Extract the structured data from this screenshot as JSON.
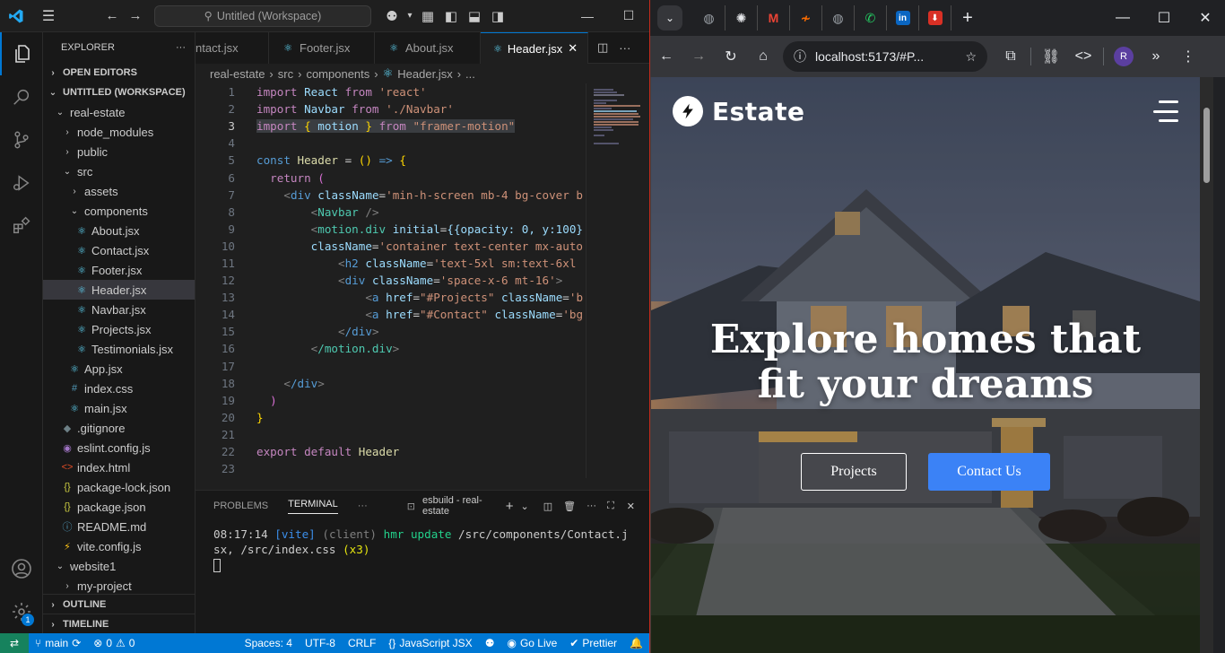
{
  "vscode": {
    "command_center": "Untitled (Workspace)",
    "sidebar": {
      "title": "EXPLORER",
      "open_editors": "OPEN EDITORS",
      "workspace": "UNTITLED (WORKSPACE)",
      "tree": [
        {
          "label": "real-estate",
          "kind": "folder-open"
        },
        {
          "label": "node_modules",
          "kind": "folder"
        },
        {
          "label": "public",
          "kind": "folder"
        },
        {
          "label": "src",
          "kind": "folder-open"
        },
        {
          "label": "assets",
          "kind": "folder"
        },
        {
          "label": "components",
          "kind": "folder-open"
        },
        {
          "label": "About.jsx",
          "kind": "jsx"
        },
        {
          "label": "Contact.jsx",
          "kind": "jsx"
        },
        {
          "label": "Footer.jsx",
          "kind": "jsx"
        },
        {
          "label": "Header.jsx",
          "kind": "jsx"
        },
        {
          "label": "Navbar.jsx",
          "kind": "jsx"
        },
        {
          "label": "Projects.jsx",
          "kind": "jsx"
        },
        {
          "label": "Testimonials.jsx",
          "kind": "jsx"
        },
        {
          "label": "App.jsx",
          "kind": "jsx"
        },
        {
          "label": "index.css",
          "kind": "css"
        },
        {
          "label": "main.jsx",
          "kind": "jsx"
        },
        {
          "label": ".gitignore",
          "kind": "git"
        },
        {
          "label": "eslint.config.js",
          "kind": "eslint"
        },
        {
          "label": "index.html",
          "kind": "html"
        },
        {
          "label": "package-lock.json",
          "kind": "json"
        },
        {
          "label": "package.json",
          "kind": "json"
        },
        {
          "label": "README.md",
          "kind": "info"
        },
        {
          "label": "vite.config.js",
          "kind": "vite"
        },
        {
          "label": "website1",
          "kind": "folder-open"
        },
        {
          "label": "my-project",
          "kind": "folder"
        }
      ],
      "outline": "OUTLINE",
      "timeline": "TIMELINE"
    },
    "tabs": [
      "ntact.jsx",
      "Footer.jsx",
      "About.jsx",
      "Header.jsx"
    ],
    "breadcrumb": [
      "real-estate",
      "src",
      "components",
      "Header.jsx",
      "..."
    ],
    "code_lines": [
      "1",
      "2",
      "3",
      "4",
      "5",
      "6",
      "7",
      "8",
      "9",
      "10",
      "11",
      "12",
      "13",
      "14",
      "15",
      "16",
      "17",
      "18",
      "19",
      "20",
      "21",
      "22",
      "23"
    ],
    "code": {
      "l1_import": "import",
      "l1_name": "React",
      "l1_from": "from",
      "l1_str": "'react'",
      "l2_import": "import",
      "l2_name": "Navbar",
      "l2_from": "from",
      "l2_str": "'./Navbar'",
      "l3_import": "import",
      "l3_open": "{",
      "l3_name": "motion",
      "l3_close": "}",
      "l3_from": "from",
      "l3_str": "\"framer-motion\"",
      "l5_const": "const",
      "l5_name": "Header",
      "l5_eq": "=",
      "l5_paren": "()",
      "l5_arrow": "=>",
      "l5_brace": "{",
      "l6_return": "return",
      "l6_paren": "(",
      "l7_tag": "div",
      "l7_attr": "className",
      "l7_val": "'min-h-screen mb-4 bg-cover b",
      "l8_tag": "Navbar",
      "l8_close": "/>",
      "l9_tag": "motion.div",
      "l9_attr": "initial",
      "l9_val": "{{opacity: 0, y:100}",
      "l10_attr": "className",
      "l10_val": "'container text-center mx-auto",
      "l11_tag": "h2",
      "l11_attr": "className",
      "l11_val": "'text-5xl sm:text-6xl",
      "l12_tag": "div",
      "l12_attr": "className",
      "l12_val": "'space-x-6 mt-16'",
      "l13_tag": "a",
      "l13_attr": "href",
      "l13_val": "\"#Projects\"",
      "l13_attr2": "className",
      "l13_val2": "'b",
      "l14_tag": "a",
      "l14_attr": "href",
      "l14_val": "\"#Contact\"",
      "l14_attr2": "className",
      "l14_val2": "'bg",
      "l15_tag": "/div",
      "l16_tag": "/motion.div",
      "l18_tag": "/div",
      "l19": ")",
      "l20": "}",
      "l22_export": "export",
      "l22_default": "default",
      "l22_name": "Header"
    },
    "panel": {
      "tabs": [
        "PROBLEMS",
        "TERMINAL"
      ],
      "terminal_name": "esbuild - real-estate",
      "time": "08:17:14",
      "vite": "[vite]",
      "client": "(client)",
      "hmr": "hmr update",
      "path1": "/src/components/Contact.j",
      "path2": "sx, /src/index.css",
      "count": "(x3)"
    },
    "status": {
      "branch": "main",
      "errors": "0",
      "warnings": "0",
      "spaces": "Spaces: 4",
      "encoding": "UTF-8",
      "eol": "CRLF",
      "language": "JavaScript JSX",
      "golive": "Go Live",
      "prettier": "Prettier"
    },
    "colors": {
      "accent": "#0078d4",
      "status_bg": "#0078d4"
    }
  },
  "browser": {
    "url": "localhost:5173/#P...",
    "profile_initial": "R",
    "tabs": [
      {
        "icon": "globe-icon",
        "color": "#9aa0a6"
      },
      {
        "icon": "openai-icon",
        "color": "#e8eaed"
      },
      {
        "icon": "gmail-icon",
        "color": "#ea4335"
      },
      {
        "icon": "zap-icon",
        "color": "#ff6d00"
      },
      {
        "icon": "globe-icon",
        "color": "#9aa0a6"
      },
      {
        "icon": "whatsapp-icon",
        "color": "#25d366"
      },
      {
        "icon": "linkedin-icon",
        "color": "#0a66c2"
      },
      {
        "icon": "download-icon",
        "color": "#d93025"
      }
    ],
    "site": {
      "brand": "Estate",
      "hero_title": "Explore homes that fit your dreams",
      "btn_projects": "Projects",
      "btn_contact": "Contact Us"
    },
    "colors": {
      "cta": "#3b82f6"
    }
  }
}
